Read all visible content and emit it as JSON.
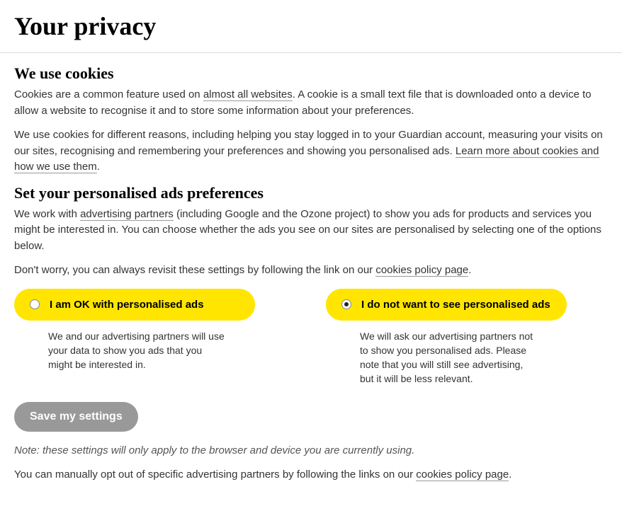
{
  "title": "Your privacy",
  "section1": {
    "heading": "We use cookies",
    "p1_a": "Cookies are a common feature used on ",
    "p1_link": "almost all websites",
    "p1_b": ". A cookie is a small text file that is downloaded onto a device to allow a website to recognise it and to store some information about your preferences.",
    "p2_a": "We use cookies for different reasons, including helping you stay logged in to your Guardian account, measuring your visits on our sites, recognising and remembering your preferences and showing you personalised ads. ",
    "p2_link": "Learn more about cookies and how we use them",
    "p2_b": "."
  },
  "section2": {
    "heading": "Set your personalised ads preferences",
    "p1_a": "We work with ",
    "p1_link": "advertising partners",
    "p1_b": " (including Google and the Ozone project) to show you ads for products and services you might be interested in. You can choose whether the ads you see on our sites are personalised by selecting one of the options below.",
    "p2_a": "Don't worry, you can always revisit these settings by following the link on our ",
    "p2_link": "cookies policy page",
    "p2_b": "."
  },
  "options": {
    "ok": {
      "label": "I am OK with personalised ads",
      "desc": "We and our advertising partners will use your data to show you ads that you might be interested in.",
      "selected": false
    },
    "no": {
      "label": "I do not want to see personalised ads",
      "desc": "We will ask our advertising partners not to show you personalised ads. Please note that you will still see advertising, but it will be less relevant.",
      "selected": true
    }
  },
  "save_button": "Save my settings",
  "note": "Note: these settings will only apply to the browser and device you are currently using.",
  "footer": {
    "a": "You can manually opt out of specific advertising partners by following the links on our ",
    "link": "cookies policy page",
    "b": "."
  }
}
